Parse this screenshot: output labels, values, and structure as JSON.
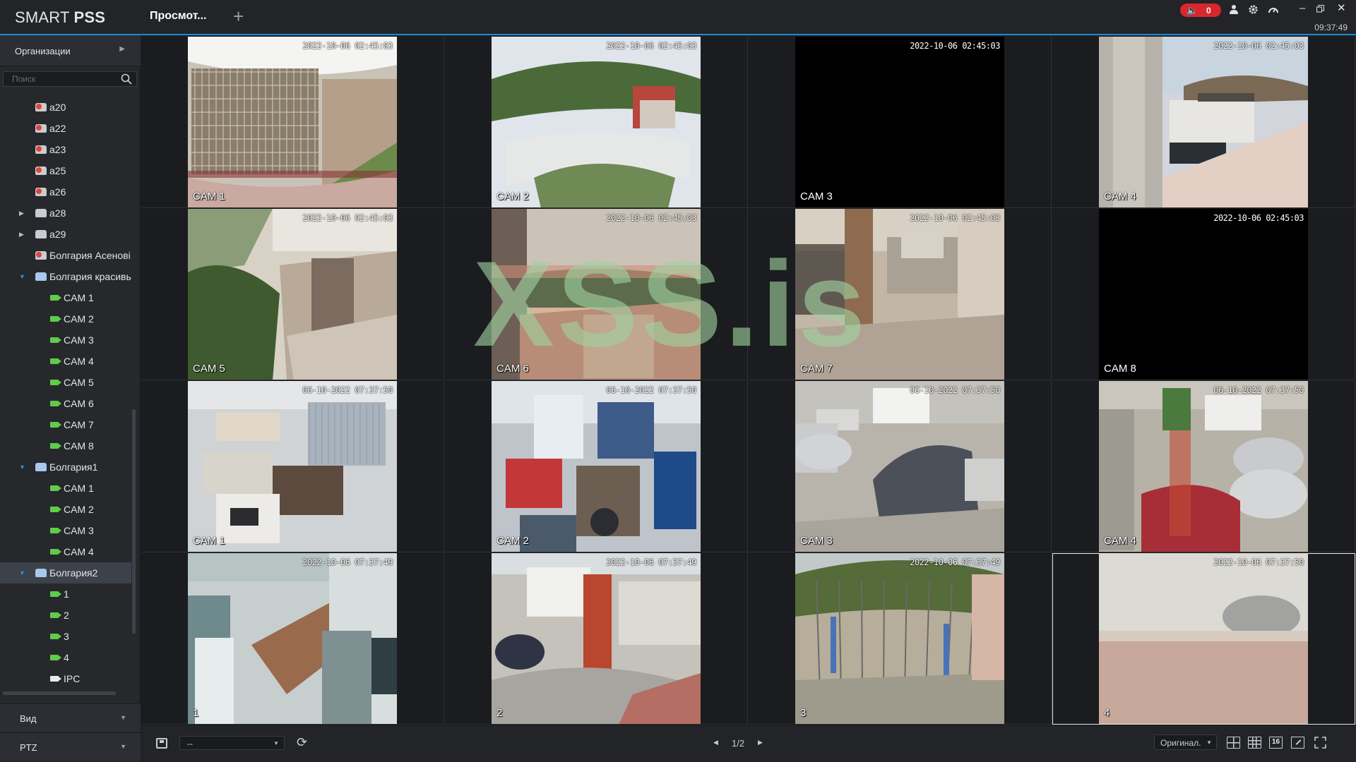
{
  "app": {
    "logo_light": "SMART ",
    "logo_bold": "PSS",
    "active_tab": "Просмот...",
    "add_tab": "+"
  },
  "titlebar": {
    "alarm_count": "0",
    "clock": "09:37:49"
  },
  "sidebar": {
    "org_label": "Организации",
    "search_placeholder": "Поиск",
    "tree": [
      {
        "label": "a20",
        "type": "device",
        "status": "offline",
        "level": 0,
        "toggle": ""
      },
      {
        "label": "a22",
        "type": "device",
        "status": "offline",
        "level": 0,
        "toggle": ""
      },
      {
        "label": "a23",
        "type": "device",
        "status": "offline",
        "level": 0,
        "toggle": ""
      },
      {
        "label": "a25",
        "type": "device",
        "status": "offline",
        "level": 0,
        "toggle": ""
      },
      {
        "label": "a26",
        "type": "device",
        "status": "offline",
        "level": 0,
        "toggle": ""
      },
      {
        "label": "a28",
        "type": "device",
        "status": "online",
        "level": 0,
        "toggle": "collapsed"
      },
      {
        "label": "a29",
        "type": "device",
        "status": "online",
        "level": 0,
        "toggle": "collapsed"
      },
      {
        "label": "Болгария Асенові",
        "type": "device",
        "status": "offline",
        "level": 0,
        "toggle": ""
      },
      {
        "label": "Болгария красивь",
        "type": "device",
        "status": "open",
        "level": 0,
        "toggle": "expanded"
      },
      {
        "label": "CAM 1",
        "type": "camera",
        "level": 1
      },
      {
        "label": "CAM 2",
        "type": "camera",
        "level": 1
      },
      {
        "label": "CAM 3",
        "type": "camera",
        "level": 1
      },
      {
        "label": "CAM 4",
        "type": "camera",
        "level": 1
      },
      {
        "label": "CAM 5",
        "type": "camera",
        "level": 1
      },
      {
        "label": "CAM 6",
        "type": "camera",
        "level": 1
      },
      {
        "label": "CAM 7",
        "type": "camera",
        "level": 1
      },
      {
        "label": "CAM 8",
        "type": "camera",
        "level": 1
      },
      {
        "label": "Болгария1",
        "type": "device",
        "status": "open",
        "level": 0,
        "toggle": "expanded"
      },
      {
        "label": "CAM 1",
        "type": "camera",
        "level": 1
      },
      {
        "label": "CAM 2",
        "type": "camera",
        "level": 1
      },
      {
        "label": "CAM 3",
        "type": "camera",
        "level": 1
      },
      {
        "label": "CAM 4",
        "type": "camera",
        "level": 1
      },
      {
        "label": "Болгария2",
        "type": "device",
        "status": "open",
        "level": 0,
        "toggle": "expanded",
        "selected": true
      },
      {
        "label": "1",
        "type": "camera",
        "level": 1
      },
      {
        "label": "2",
        "type": "camera",
        "level": 1
      },
      {
        "label": "3",
        "type": "camera",
        "level": 1
      },
      {
        "label": "4",
        "type": "camera",
        "level": 1
      },
      {
        "label": "IPC",
        "type": "camera-white",
        "level": 1
      }
    ],
    "view_label": "Вид",
    "ptz_label": "PTZ"
  },
  "grid": [
    {
      "label": "CAM 1",
      "timestamp": "2022-10-06 02:45:03",
      "scene": "aviary"
    },
    {
      "label": "CAM 2",
      "timestamp": "2022-10-06 02:45:03",
      "scene": "fisheye-yard"
    },
    {
      "label": "CAM 3",
      "timestamp": "2022-10-06 02:45:03",
      "scene": "black"
    },
    {
      "label": "CAM 4",
      "timestamp": "2022-10-06 02:45:03",
      "scene": "balcony"
    },
    {
      "label": "CAM 5",
      "timestamp": "2022-10-06 02:45:03",
      "scene": "garden"
    },
    {
      "label": "CAM 6",
      "timestamp": "2022-10-06 02:45:03",
      "scene": "sunset"
    },
    {
      "label": "CAM 7",
      "timestamp": "2022-10-06 02:45:03",
      "scene": "porch"
    },
    {
      "label": "CAM 8",
      "timestamp": "2022-10-06 02:45:03",
      "scene": "black"
    },
    {
      "label": "CAM 1",
      "timestamp": "06-10-2022 07:37:50",
      "scene": "office"
    },
    {
      "label": "CAM 2",
      "timestamp": "06-10-2022 07:37:50",
      "scene": "workshop"
    },
    {
      "label": "CAM 3",
      "timestamp": "06-10-2022 07:37:50",
      "scene": "parking"
    },
    {
      "label": "CAM 4",
      "timestamp": "06-10-2022 07:37:50",
      "scene": "carlot"
    },
    {
      "label": "1",
      "timestamp": "2022-10-06 07:37:49",
      "scene": "stairs"
    },
    {
      "label": "2",
      "timestamp": "2022-10-06 07:37:49",
      "scene": "street"
    },
    {
      "label": "3",
      "timestamp": "2022-10-06 07:37:49",
      "scene": "vineyard"
    },
    {
      "label": "4",
      "timestamp": "2022-10-06 07:37:50",
      "scene": "foggy",
      "selected": true
    }
  ],
  "watermark": "XSS.is",
  "bottombar": {
    "view_select_value": "--",
    "page_indicator": "1/2",
    "stream_select_value": "Оригинал.",
    "layout_16_label": "16"
  }
}
